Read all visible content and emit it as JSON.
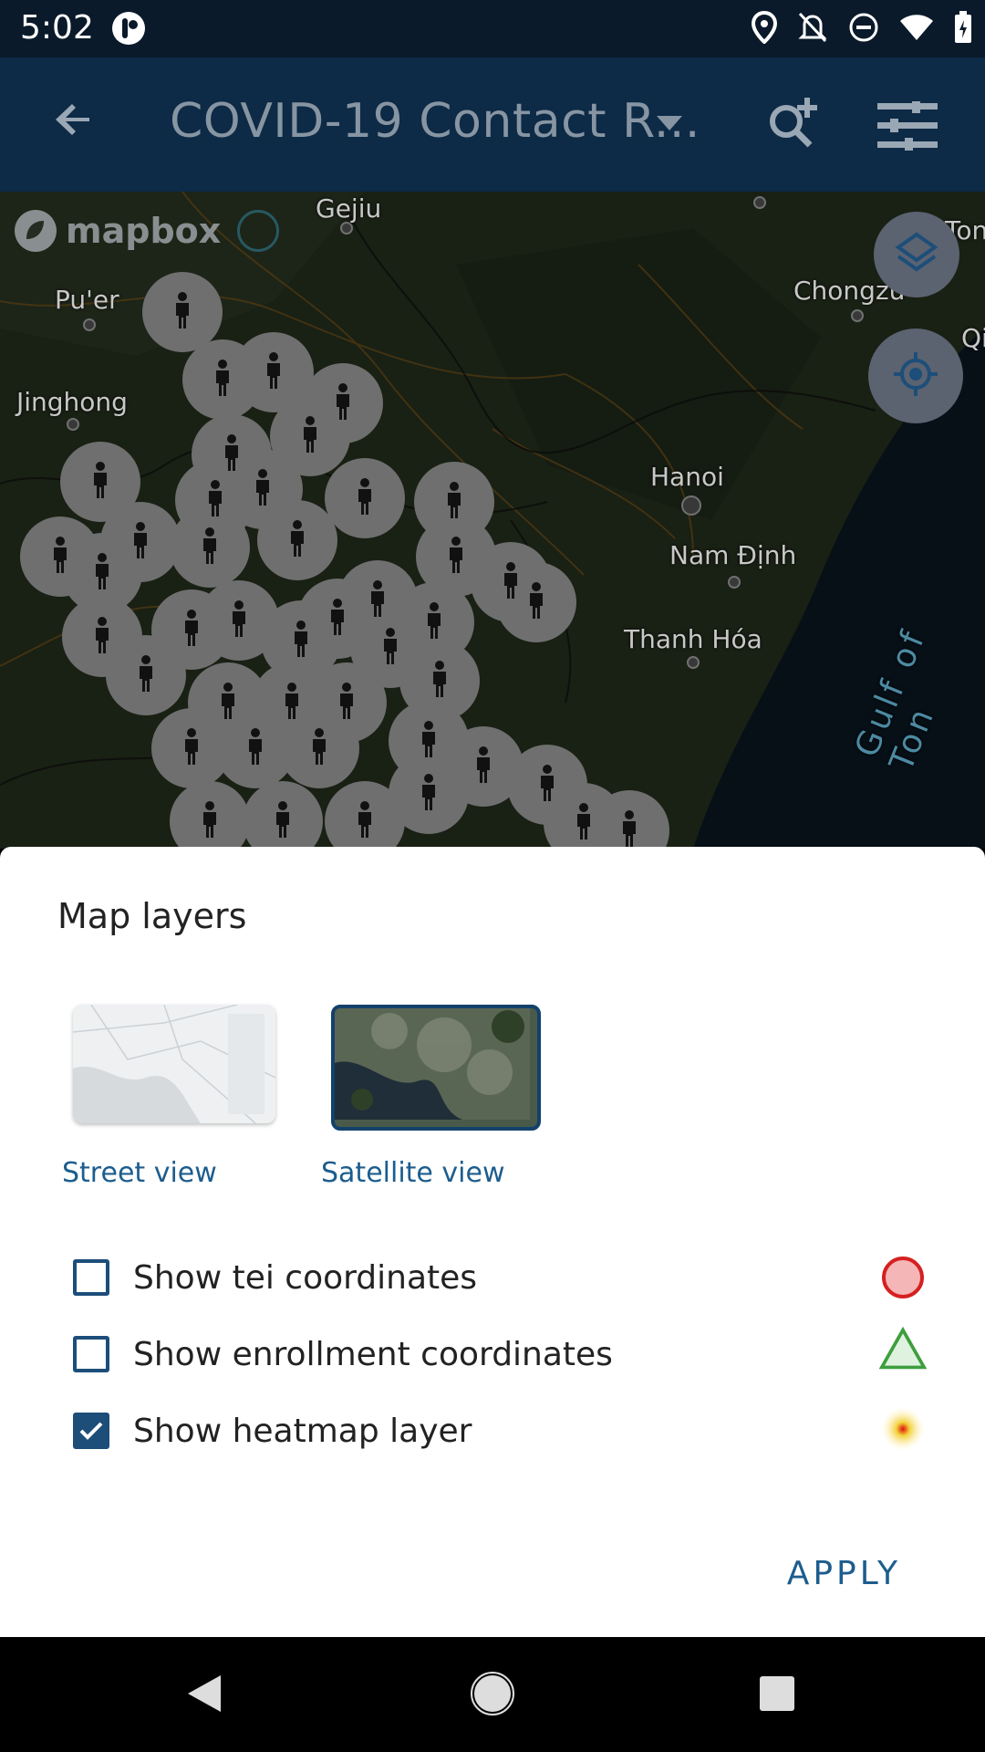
{
  "status_bar": {
    "time": "5:02",
    "icons": [
      "app-logo-icon",
      "location-icon",
      "notifications-off-icon",
      "do-not-disturb-icon",
      "wifi-icon",
      "battery-charging-icon"
    ]
  },
  "app_bar": {
    "title": "COVID-19 Contact R...",
    "icons": [
      "back-arrow-icon",
      "dropdown-caret-icon",
      "search-add-icon",
      "filter-icon"
    ]
  },
  "map": {
    "attribution": "mapbox",
    "place_labels": [
      "Gejiu",
      "Pu'er",
      "Jinghong",
      "Chongzu",
      "Qi",
      "Hanoi",
      "Nam Định",
      "Thanh Hóa",
      "Gulf of Ton",
      "Tonn"
    ],
    "buttons": [
      "layers-icon",
      "my-location-icon"
    ]
  },
  "sheet": {
    "title": "Map layers",
    "base_layers": [
      {
        "label": "Street view",
        "selected": false
      },
      {
        "label": "Satellite view",
        "selected": true
      }
    ],
    "options": [
      {
        "label": "Show tei coordinates",
        "checked": false,
        "legend_icon": "red-circle-icon"
      },
      {
        "label": "Show enrollment coordinates",
        "checked": false,
        "legend_icon": "green-triangle-icon"
      },
      {
        "label": "Show heatmap layer",
        "checked": true,
        "legend_icon": "heatmap-dot-icon"
      }
    ],
    "apply_label": "APPLY"
  },
  "colors": {
    "primary": "#0d2a46",
    "accent": "#1c5d8e",
    "checkbox": "#1d4e7a"
  }
}
